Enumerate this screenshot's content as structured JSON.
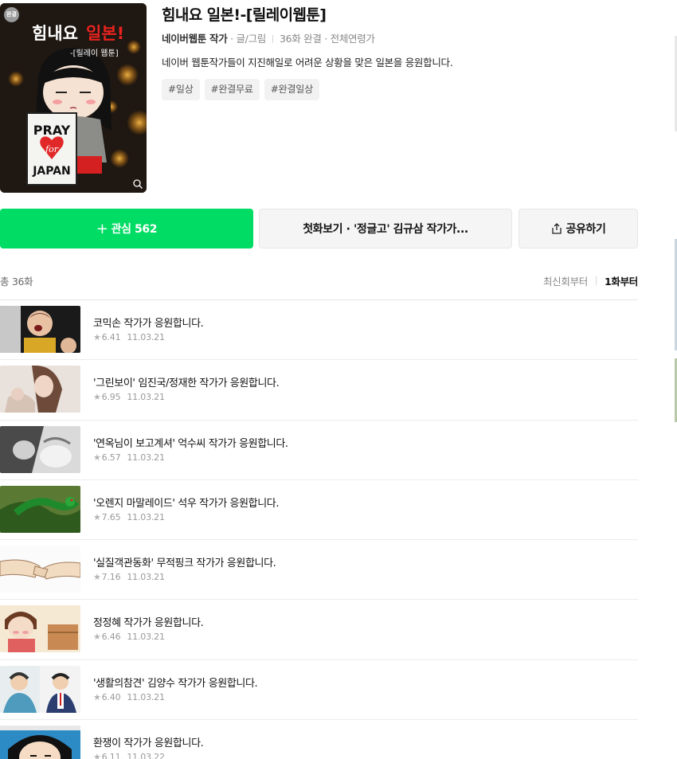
{
  "webtoon": {
    "badge": "완결",
    "thumb_title_a": "힘내요",
    "thumb_title_b": "일본!",
    "thumb_subtitle": "-[릴레이 웹툰]",
    "thumb_sign": [
      "PRAY",
      "for",
      "JAPAN"
    ],
    "title": "힘내요 일본!-[릴레이웹툰]",
    "author": "네이버웹툰 작가",
    "author_role": " · 글/그림",
    "episodes_info": "36화 완결",
    "age": " · 전체연령가",
    "description": "네이버 웹툰작가들이 지진해일로 어려운 상황을 맞은 일본을 응원합니다.",
    "tags": [
      "#일상",
      "#완결무료",
      "#완결일상"
    ]
  },
  "actions": {
    "favorite_plus": "+",
    "favorite_label": "관심 562",
    "first_episode": "첫화보기 · '정글고' 김규삼 작가가...",
    "share": "공유하기"
  },
  "list": {
    "total": "총 36화",
    "sort_newest": "최신회부터",
    "sort_first": "1화부터"
  },
  "episodes": [
    {
      "title": "코믹손 작가가 응원합니다.",
      "rating": "6.41",
      "date": "11.03.21"
    },
    {
      "title": "'그린보이' 임진국/정재한 작가가 응원합니다.",
      "rating": "6.95",
      "date": "11.03.21"
    },
    {
      "title": "'연옥님이 보고계셔' 억수씨 작가가 응원합니다.",
      "rating": "6.57",
      "date": "11.03.21"
    },
    {
      "title": "'오렌지 마말레이드' 석우 작가가 응원합니다.",
      "rating": "7.65",
      "date": "11.03.21"
    },
    {
      "title": "'실질객관동화' 무적핑크 작가가 응원합니다.",
      "rating": "7.16",
      "date": "11.03.21"
    },
    {
      "title": "정정혜 작가가 응원합니다.",
      "rating": "6.46",
      "date": "11.03.21"
    },
    {
      "title": "'생활의참견' 김양수 작가가 응원합니다.",
      "rating": "6.40",
      "date": "11.03.21"
    },
    {
      "title": "환쟁이 작가가 응원합니다.",
      "rating": "6.11",
      "date": "11.03.22"
    }
  ],
  "colors": {
    "accent_green": "#00dc64",
    "button_gray": "#f5f5f5",
    "tag_gray": "#f2f2f2"
  },
  "icons": {
    "plus": "plus-icon",
    "share": "share-icon",
    "zoom": "magnifier-icon",
    "star": "star-icon"
  }
}
